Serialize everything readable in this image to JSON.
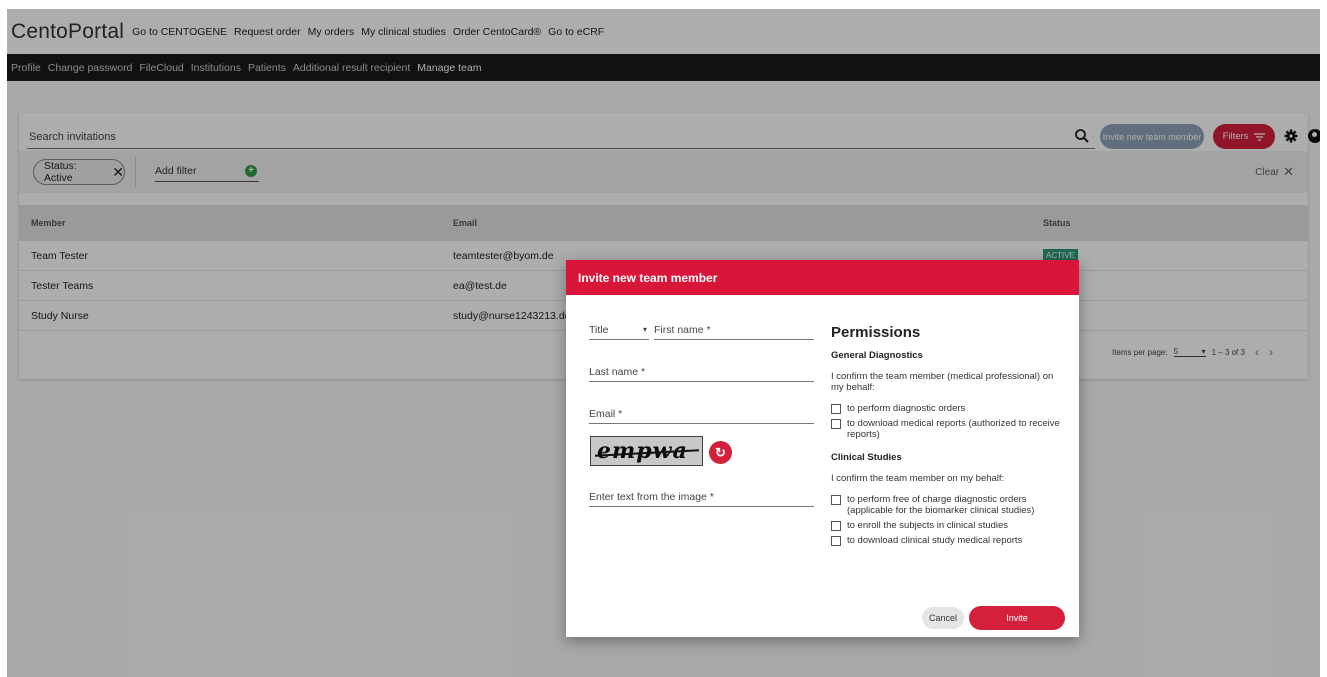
{
  "brand": "CentoPortal",
  "top_nav": [
    "Go to CENTOGENE",
    "Request order",
    "My orders",
    "My clinical studies",
    "Order CentoCard®",
    "Go to eCRF"
  ],
  "sub_nav": [
    "Profile",
    "Change password",
    "FileCloud",
    "Institutions",
    "Patients",
    "Additional result recipient",
    "Manage team"
  ],
  "sub_nav_active": "Manage team",
  "search": {
    "placeholder": "Search invitations"
  },
  "toolbar": {
    "invite_label": "Invite new team member",
    "filters_label": "Filters"
  },
  "filters": {
    "chip_label": "Status: Active",
    "add_filter_label": "Add filter",
    "clear_label": "Clear"
  },
  "table": {
    "headers": [
      "Member",
      "Email",
      "Status"
    ],
    "rows": [
      {
        "member": "Team Tester",
        "email": "teamtester@byom.de",
        "status": "ACTIVE"
      },
      {
        "member": "Tester Teams",
        "email": "ea@test.de",
        "status": ""
      },
      {
        "member": "Study Nurse",
        "email": "study@nurse1243213.de",
        "status": ""
      }
    ]
  },
  "pagination": {
    "label": "Items per page:",
    "per_page": "5",
    "range": "1 – 3 of 3"
  },
  "modal": {
    "title": "Invite new team member",
    "fields": {
      "title": "Title",
      "first_name": "First name *",
      "last_name": "Last name *",
      "email": "Email *",
      "captcha_text": "Enter text from the image *"
    },
    "captcha_image_text": "empwa",
    "permissions": {
      "heading": "Permissions",
      "general_heading": "General Diagnostics",
      "general_intro": "I confirm the team member (medical professional) on my behalf:",
      "general_options": [
        "to perform diagnostic orders",
        "to download medical reports (authorized to receive reports)"
      ],
      "clinical_heading": "Clinical Studies",
      "clinical_intro": "I confirm the team member on my behalf:",
      "clinical_options": [
        "to perform free of charge diagnostic orders (applicable for the biomarker clinical studies)",
        "to enroll the subjects in clinical studies",
        "to download clinical study medical reports"
      ]
    },
    "cancel_label": "Cancel",
    "invite_label": "Invite"
  },
  "colors": {
    "primary": "#d4203b",
    "header_bar": "#1a1a1a",
    "status_active": "#2e9d7c"
  }
}
